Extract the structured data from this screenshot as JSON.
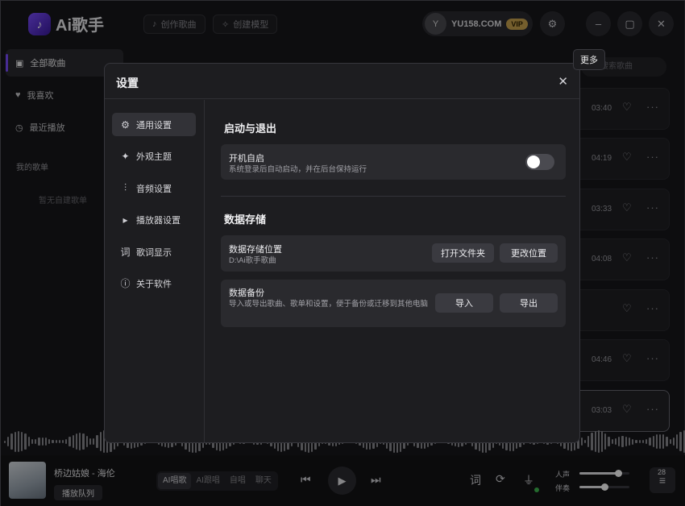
{
  "app": {
    "name": "Ai歌手"
  },
  "topbar": {
    "create_song": "创作歌曲",
    "create_model": "创建模型",
    "user_initial": "Y",
    "user_name": "YU158.COM",
    "vip": "VIP",
    "tooltip_more": "更多"
  },
  "sidebar": {
    "items": [
      {
        "label": "全部歌曲",
        "icon": "music-folder-icon",
        "active": true
      },
      {
        "label": "我喜欢",
        "icon": "heart-icon",
        "active": false
      },
      {
        "label": "最近播放",
        "icon": "history-icon",
        "active": false
      }
    ],
    "my_playlists": "我的歌单",
    "empty_playlists": "暂无自建歌单"
  },
  "search": {
    "placeholder": "搜索歌曲"
  },
  "songs": [
    {
      "time": "03:40"
    },
    {
      "time": "04:19"
    },
    {
      "time": "03:33"
    },
    {
      "time": "04:08"
    },
    {
      "time": ""
    },
    {
      "time": "04:46"
    },
    {
      "time": "03:03"
    }
  ],
  "player": {
    "title": "桥边姑娘 - 海伦",
    "queue": "播放队列",
    "modes": [
      "AI唱歌",
      "AI跟唱",
      "自唱",
      "聊天"
    ],
    "vocal_label": "人声",
    "accompaniment_label": "伴奏",
    "vocal_level": 0.78,
    "accompaniment_level": 0.5,
    "queue_count": "28"
  },
  "settings": {
    "title": "设置",
    "nav": [
      {
        "label": "通用设置",
        "icon": "gear-icon",
        "active": true
      },
      {
        "label": "外观主题",
        "icon": "sparkle-icon",
        "active": false
      },
      {
        "label": "音频设置",
        "icon": "waveform-icon",
        "active": false
      },
      {
        "label": "播放器设置",
        "icon": "play-icon",
        "active": false
      },
      {
        "label": "歌词显示",
        "icon": "lyrics-icon",
        "active": false
      },
      {
        "label": "关于软件",
        "icon": "info-icon",
        "active": false
      }
    ],
    "startup": {
      "section_title": "启动与退出",
      "autostart_title": "开机自启",
      "autostart_desc": "系统登录后自动启动，并在后台保持运行",
      "autostart_on": false
    },
    "storage": {
      "section_title": "数据存储",
      "location_title": "数据存储位置",
      "location_path": "D:\\Ai歌手歌曲",
      "open_folder": "打开文件夹",
      "change_location": "更改位置",
      "backup_title": "数据备份",
      "backup_desc": "导入或导出歌曲、歌单和设置，便于备份或迁移到其他电脑",
      "import": "导入",
      "export": "导出"
    }
  }
}
